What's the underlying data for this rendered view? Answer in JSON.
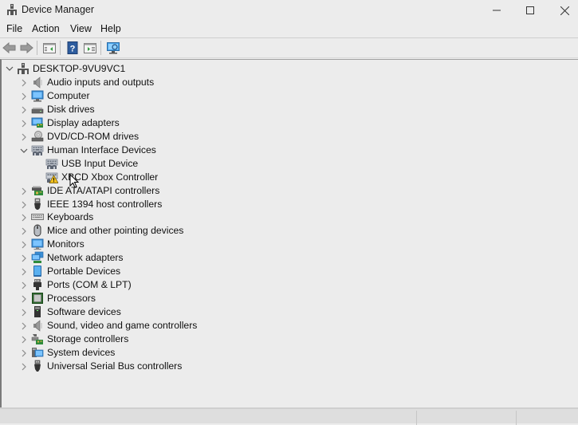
{
  "window": {
    "title": "Device Manager",
    "controls": {
      "minimize": "minimize-icon",
      "maximize": "maximize-icon",
      "close": "close-icon"
    }
  },
  "menu": {
    "items": [
      {
        "label": "File"
      },
      {
        "label": "Action"
      },
      {
        "label": "View"
      },
      {
        "label": "Help"
      }
    ]
  },
  "toolbar": {
    "buttons": [
      {
        "name": "back",
        "icon": "back-arrow-icon",
        "enabled": false
      },
      {
        "name": "forward",
        "icon": "forward-arrow-icon",
        "enabled": false
      },
      {
        "name": "show-hide-console-tree",
        "icon": "console-tree-icon"
      },
      {
        "name": "help",
        "icon": "help-icon"
      },
      {
        "name": "show-hide-action-pane",
        "icon": "action-pane-icon"
      },
      {
        "name": "scan-hardware",
        "icon": "monitor-scan-icon"
      }
    ]
  },
  "tree": {
    "root": {
      "label": "DESKTOP-9VU9VC1",
      "expanded": true,
      "icon": "computer-network-icon"
    },
    "nodes": [
      {
        "label": "Audio inputs and outputs",
        "icon": "speaker-icon",
        "expanded": false,
        "level": 1
      },
      {
        "label": "Computer",
        "icon": "computer-icon",
        "expanded": false,
        "level": 1
      },
      {
        "label": "Disk drives",
        "icon": "disk-drive-icon",
        "expanded": false,
        "level": 1
      },
      {
        "label": "Display adapters",
        "icon": "display-adapter-icon",
        "expanded": false,
        "level": 1
      },
      {
        "label": "DVD/CD-ROM drives",
        "icon": "dvd-drive-icon",
        "expanded": false,
        "level": 1
      },
      {
        "label": "Human Interface Devices",
        "icon": "hid-icon",
        "expanded": true,
        "level": 1
      },
      {
        "label": "USB Input Device",
        "icon": "hid-icon",
        "level": 2
      },
      {
        "label": "XBCD Xbox Controller",
        "icon": "hid-warning-icon",
        "level": 2,
        "warning": true
      },
      {
        "label": "IDE ATA/ATAPI controllers",
        "icon": "ide-controller-icon",
        "expanded": false,
        "level": 1
      },
      {
        "label": "IEEE 1394 host controllers",
        "icon": "ieee1394-icon",
        "expanded": false,
        "level": 1
      },
      {
        "label": "Keyboards",
        "icon": "keyboard-icon",
        "expanded": false,
        "level": 1
      },
      {
        "label": "Mice and other pointing devices",
        "icon": "mouse-icon",
        "expanded": false,
        "level": 1
      },
      {
        "label": "Monitors",
        "icon": "monitor-icon",
        "expanded": false,
        "level": 1
      },
      {
        "label": "Network adapters",
        "icon": "network-adapter-icon",
        "expanded": false,
        "level": 1
      },
      {
        "label": "Portable Devices",
        "icon": "portable-device-icon",
        "expanded": false,
        "level": 1
      },
      {
        "label": "Ports (COM & LPT)",
        "icon": "port-icon",
        "expanded": false,
        "level": 1
      },
      {
        "label": "Processors",
        "icon": "processor-icon",
        "expanded": false,
        "level": 1
      },
      {
        "label": "Software devices",
        "icon": "software-device-icon",
        "expanded": false,
        "level": 1
      },
      {
        "label": "Sound, video and game controllers",
        "icon": "speaker-icon",
        "expanded": false,
        "level": 1
      },
      {
        "label": "Storage controllers",
        "icon": "storage-controller-icon",
        "expanded": false,
        "level": 1
      },
      {
        "label": "System devices",
        "icon": "system-device-icon",
        "expanded": false,
        "level": 1
      },
      {
        "label": "Universal Serial Bus controllers",
        "icon": "usb-icon",
        "expanded": false,
        "level": 1
      }
    ]
  },
  "colors": {
    "background": "#ececec",
    "icon_blue": "#3a8fd6",
    "warning_yellow": "#f2c01e"
  }
}
